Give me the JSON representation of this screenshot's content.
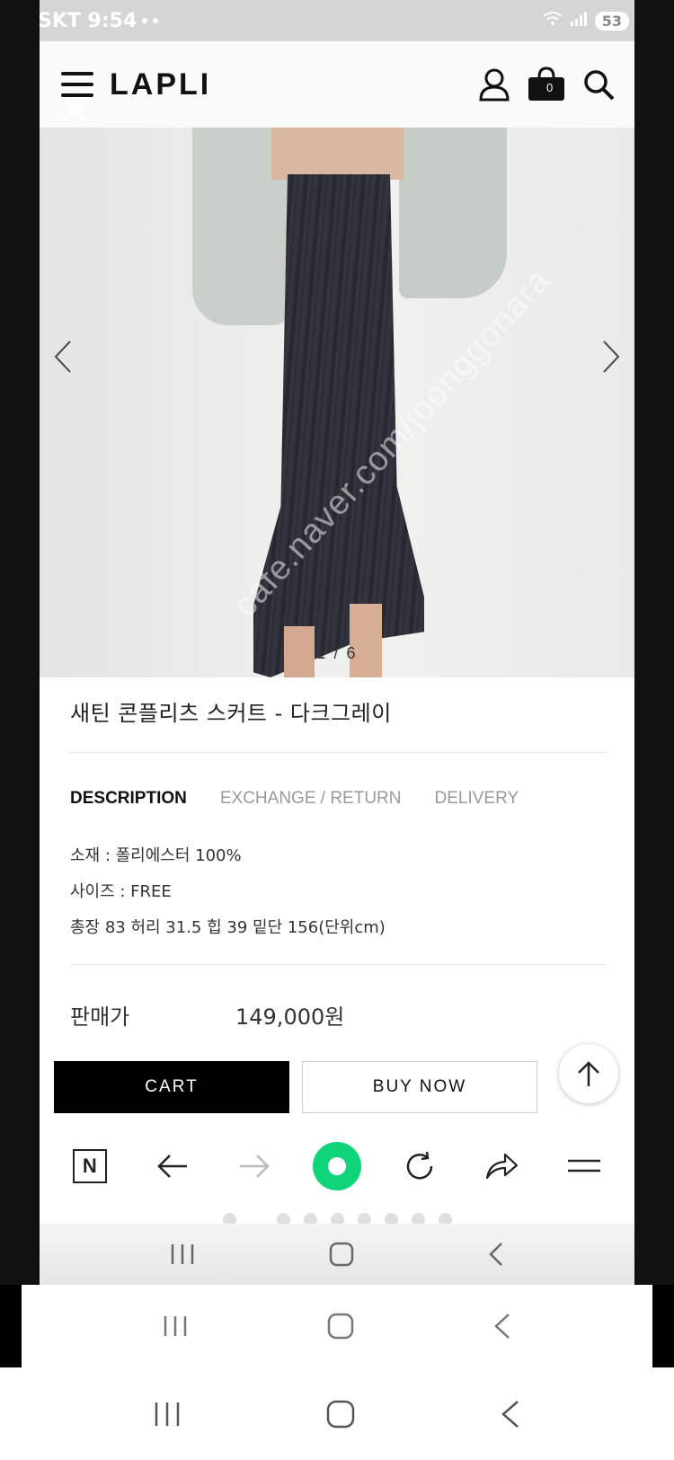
{
  "status_bar": {
    "carrier_time": "SKT 9:54",
    "battery": "53"
  },
  "header": {
    "brand": "LAPLI",
    "cart_count": "0"
  },
  "gallery": {
    "counter": "1 / 6",
    "watermark": "cafe.naver.com/joonggonara"
  },
  "product": {
    "title": "새틴 콘플리츠 스커트 - 다크그레이",
    "tabs": [
      {
        "label": "DESCRIPTION",
        "active": true
      },
      {
        "label": "EXCHANGE / RETURN",
        "active": false
      },
      {
        "label": "DELIVERY",
        "active": false
      }
    ],
    "description": [
      "소재 : 폴리에스터 100%",
      "사이즈 : FREE",
      "총장 83 허리 31.5 힙 39 밑단 156(단위cm)"
    ],
    "price_label": "판매가",
    "price_value": "149,000원"
  },
  "actions": {
    "cart": "CART",
    "buy_now": "BUY NOW"
  },
  "browser_toolbar": {
    "n_label": "N"
  },
  "colors": {
    "accent_green": "#0fd47a",
    "cart_button": "#000000"
  }
}
